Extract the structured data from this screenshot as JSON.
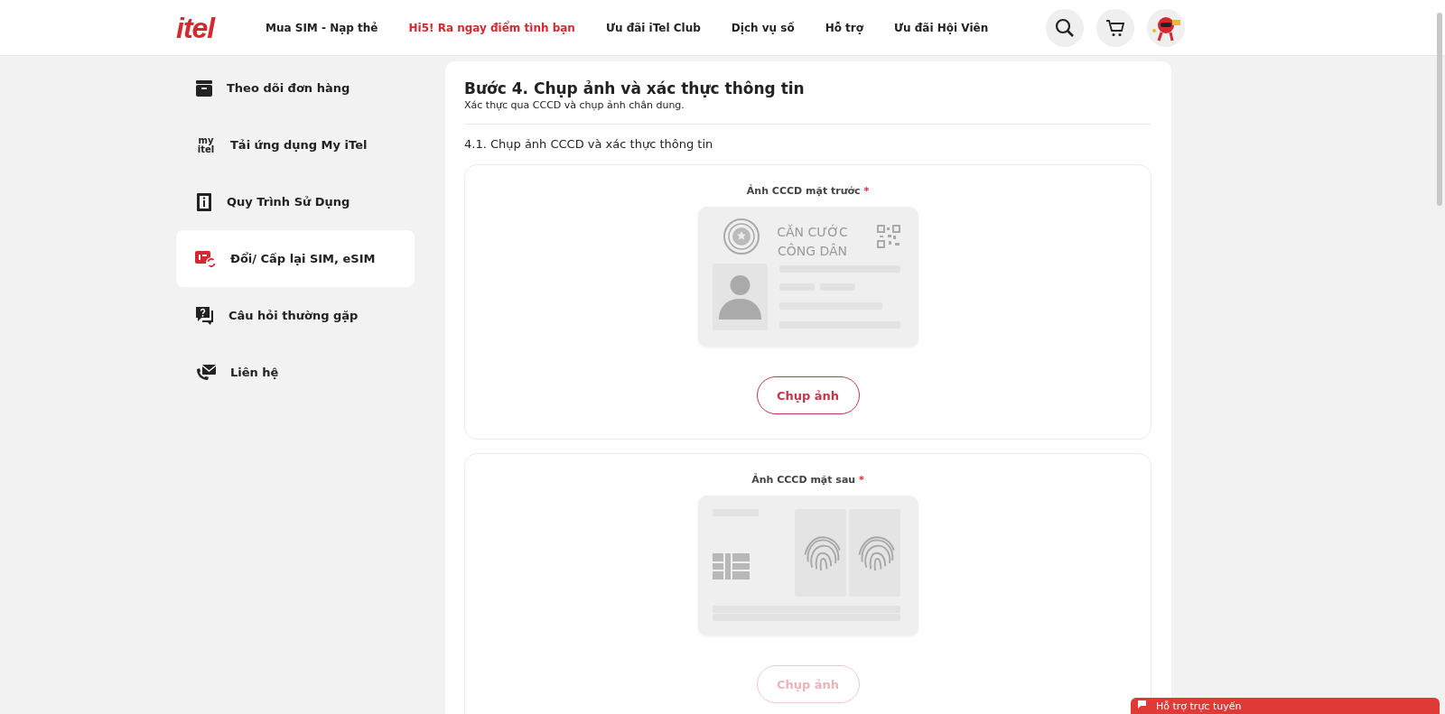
{
  "header": {
    "logo": "itel",
    "nav": [
      {
        "label": "Mua SIM - Nạp thẻ",
        "highlighted": false
      },
      {
        "label": "Hi5! Ra ngay điểm tình bạn",
        "highlighted": true
      },
      {
        "label": "Ưu đãi iTel Club",
        "highlighted": false
      },
      {
        "label": "Dịch vụ số",
        "highlighted": false
      },
      {
        "label": "Hỗ trợ",
        "highlighted": false
      },
      {
        "label": "Ưu đãi Hội Viên",
        "highlighted": false
      }
    ]
  },
  "sidebar": {
    "items": [
      {
        "label": "Theo dõi đơn hàng",
        "kind": "box",
        "selected": false
      },
      {
        "label": "Tải ứng dụng My iTel",
        "kind": "app",
        "icon_text": [
          "my",
          "itel"
        ],
        "selected": false
      },
      {
        "label": "Quy Trình Sử Dụng",
        "kind": "info",
        "selected": false
      },
      {
        "label": "Đổi/ Cấp lại SIM, eSIM",
        "kind": "sim",
        "selected": true
      },
      {
        "label": "Câu hỏi thường gặp",
        "kind": "faq",
        "selected": false
      },
      {
        "label": "Liên hệ",
        "kind": "contact",
        "selected": false
      }
    ]
  },
  "step": {
    "title": "Bước 4. Chụp ảnh và xác thực thông tin",
    "subtitle": "Xác thực qua CCCD và chụp ảnh chân dung.",
    "section": "4.1. Chụp ảnh CCCD và xác thực thông tin",
    "uploads": [
      {
        "label": "Ảnh CCCD mặt trước",
        "required_mark": "*",
        "kind": "front",
        "card_text": [
          "CĂN CƯỚC",
          "CÔNG DÂN"
        ],
        "button": "Chụp ảnh",
        "disabled": false
      },
      {
        "label": "Ảnh CCCD mặt sau",
        "required_mark": "*",
        "kind": "back",
        "button": "Chụp ảnh",
        "disabled": true
      }
    ]
  },
  "chat": {
    "label": "Hỗ trợ trực tuyến"
  }
}
